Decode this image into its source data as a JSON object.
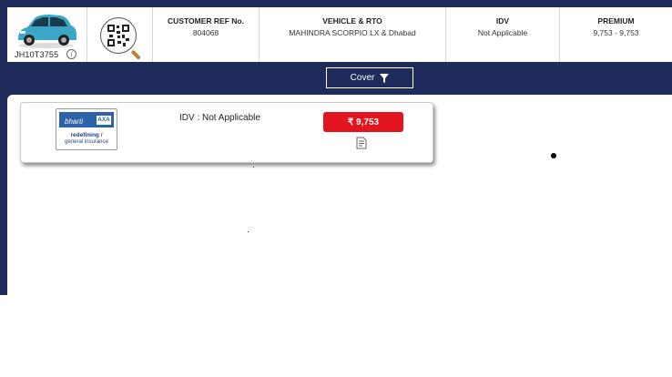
{
  "vehicle": {
    "registration": "JH10T3755",
    "car_color": "#3aa7c6"
  },
  "header": {
    "customer_ref": {
      "label": "CUSTOMER REF No.",
      "value": "804068"
    },
    "vehicle_rto": {
      "label": "VEHICLE & RTO",
      "value": "MAHINDRA SCORPIO LX & Dhabad"
    },
    "idv": {
      "label": "IDV",
      "value": "Not Applicable"
    },
    "premium": {
      "label": "PREMIUM",
      "value": "9,753 - 9,753"
    }
  },
  "filter": {
    "label": "Cover",
    "icon": "filter-icon"
  },
  "quotes": [
    {
      "insurer_logo": {
        "brand": "bharti",
        "partner": "AXA",
        "tagline_1": "redefining",
        "tagline_2": "general insurance"
      },
      "idv_text": "IDV : Not Applicable",
      "price": "₹ 9,753",
      "price_color": "#e2141f"
    }
  ],
  "colors": {
    "frame": "#1f2b5a",
    "accent_red": "#e2141f"
  }
}
